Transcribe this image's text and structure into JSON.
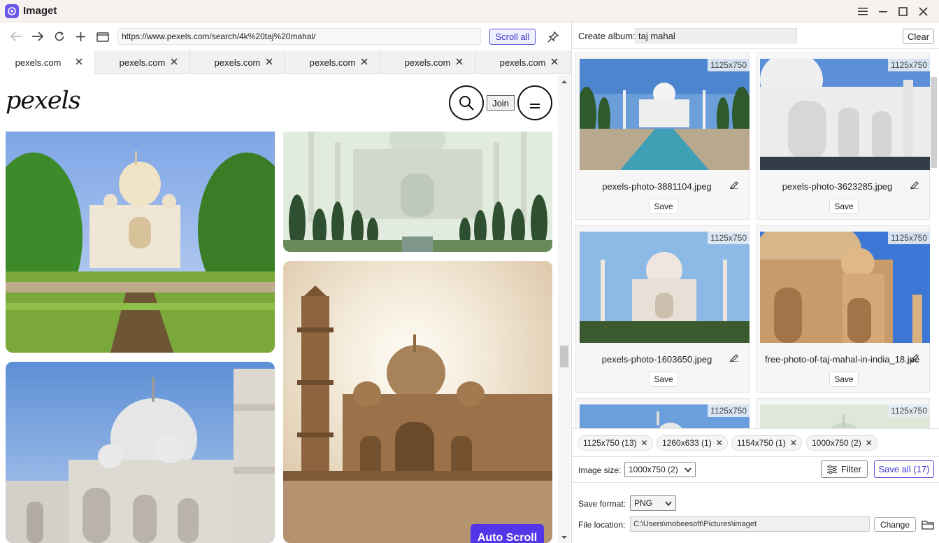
{
  "app": {
    "title": "Imaget"
  },
  "window_controls": [
    "menu-icon",
    "minimize-icon",
    "maximize-icon",
    "close-icon"
  ],
  "browser": {
    "url": "https://www.pexels.com/search/4k%20taj%20mahal/",
    "scroll_all_label": "Scroll all",
    "tabs": [
      {
        "label": "pexels.com",
        "active": true
      },
      {
        "label": "pexels.com",
        "active": false
      },
      {
        "label": "pexels.com",
        "active": false
      },
      {
        "label": "pexels.com",
        "active": false
      },
      {
        "label": "pexels.com",
        "active": false
      },
      {
        "label": "pexels.com",
        "active": false
      }
    ]
  },
  "page": {
    "logo": "pexels",
    "join_label": "Join",
    "auto_scroll_label": "Auto Scroll"
  },
  "panel": {
    "album_label": "Create album:",
    "album_value": "taj mahal",
    "clear_label": "Clear",
    "cards": [
      {
        "dims": "1125x750",
        "filename": "pexels-photo-3881104.jpeg",
        "save_label": "Save"
      },
      {
        "dims": "1125x750",
        "filename": "pexels-photo-3623285.jpeg",
        "save_label": "Save"
      },
      {
        "dims": "1125x750",
        "filename": "pexels-photo-1603650.jpeg",
        "save_label": "Save"
      },
      {
        "dims": "1125x750",
        "filename": "free-photo-of-taj-mahal-in-india_18.jpe",
        "save_label": "Save"
      },
      {
        "dims": "1125x750",
        "filename": "",
        "save_label": ""
      },
      {
        "dims": "1125x750",
        "filename": "",
        "save_label": ""
      }
    ],
    "chips": [
      "1125x750 (13)",
      "1260x633 (1)",
      "1154x750 (1)",
      "1000x750 (2)"
    ],
    "image_size_label": "Image size:",
    "image_size_value": "1000x750 (2)",
    "filter_label": "Filter",
    "save_all_label": "Save all (17)",
    "save_format_label": "Save format:",
    "save_format_value": "PNG",
    "file_location_label": "File location:",
    "file_location_value": "C:\\Users\\mobeesoft\\Pictures\\imaget",
    "change_label": "Change"
  },
  "colors": {
    "accent": "#5436e8",
    "titlebar": "#f7f1ef"
  }
}
